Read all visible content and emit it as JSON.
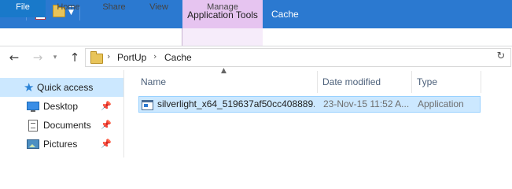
{
  "window": {
    "title": "Cache",
    "context_tab": "Application Tools"
  },
  "quick_access_toolbar": {
    "icons": [
      "folder-icon",
      "properties-icon",
      "new-folder-icon",
      "customize-dropdown-icon"
    ]
  },
  "ribbon": {
    "tabs": [
      {
        "label": "File"
      },
      {
        "label": "Home"
      },
      {
        "label": "Share"
      },
      {
        "label": "View"
      },
      {
        "label": "Manage"
      }
    ]
  },
  "address": {
    "breadcrumb": [
      "PortUp",
      "Cache"
    ],
    "separator": "›"
  },
  "nav_pane": {
    "items": [
      {
        "label": "Quick access",
        "icon": "star-icon",
        "selected": true,
        "pinned": false
      },
      {
        "label": "Desktop",
        "icon": "desktop-icon",
        "pinned": true
      },
      {
        "label": "Documents",
        "icon": "documents-icon",
        "pinned": true
      },
      {
        "label": "Pictures",
        "icon": "pictures-icon",
        "pinned": true
      }
    ],
    "pin_glyph": "📌"
  },
  "file_list": {
    "columns": [
      "Name",
      "Date modified",
      "Type"
    ],
    "sort_column": "Name",
    "rows": [
      {
        "name": "silverlight_x64_519637af50cc408889...",
        "date": "23-Nov-15 11:52 A...",
        "type": "Application",
        "selected": true
      }
    ]
  },
  "colors": {
    "titlebar": "#2b79d0",
    "context_tab": "#e6c4f0",
    "file_tab": "#1979ca",
    "selection": "#cce8ff"
  }
}
